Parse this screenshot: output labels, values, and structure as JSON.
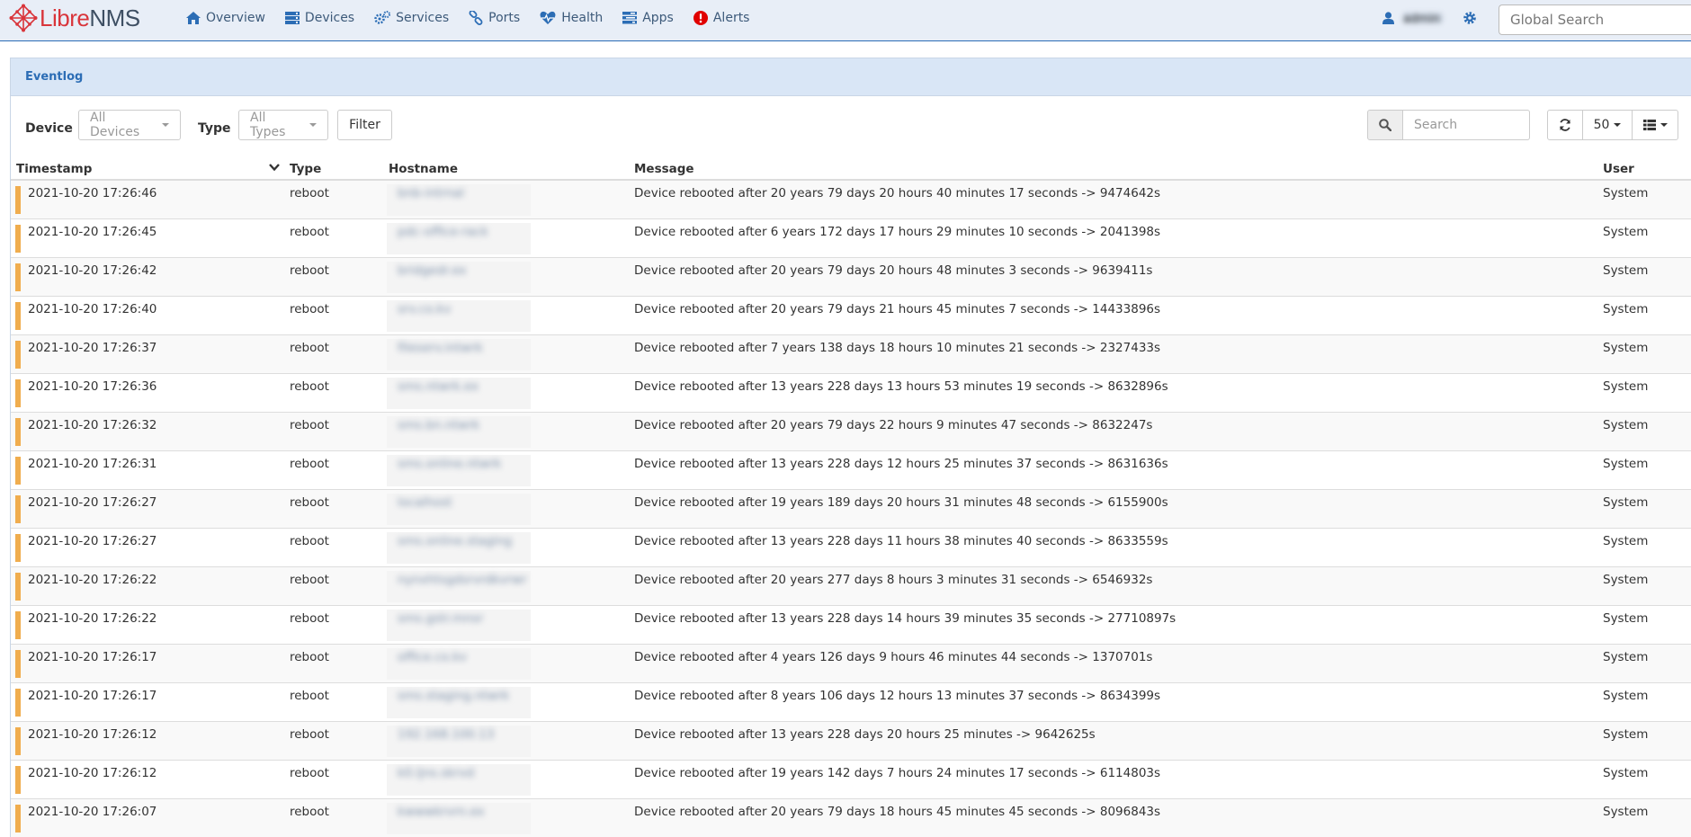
{
  "brand": {
    "part1": "Libre",
    "part2": "NMS"
  },
  "nav": [
    {
      "label": "Overview",
      "icon": "home-icon"
    },
    {
      "label": "Devices",
      "icon": "server-icon"
    },
    {
      "label": "Services",
      "icon": "cogs-icon"
    },
    {
      "label": "Ports",
      "icon": "link-icon"
    },
    {
      "label": "Health",
      "icon": "heartbeat-icon"
    },
    {
      "label": "Apps",
      "icon": "tasks-icon"
    },
    {
      "label": "Alerts",
      "icon": "exclamation-circle-icon"
    }
  ],
  "user": {
    "name": "admin",
    "icon": "user-icon"
  },
  "settings_icon": "gear-icon",
  "global_search": {
    "placeholder": "Global Search"
  },
  "panel": {
    "title": "Eventlog"
  },
  "filters": {
    "device_label": "Device",
    "device_value": "All Devices",
    "type_label": "Type",
    "type_value": "All Types",
    "filter_button": "Filter"
  },
  "table_search": {
    "placeholder": "Search"
  },
  "page_size": "50",
  "columns": {
    "timestamp": "Timestamp",
    "type": "Type",
    "hostname": "Hostname",
    "message": "Message",
    "user": "User"
  },
  "colors": {
    "accent": "#2c6db5",
    "severity_warning": "#f0ad4e",
    "brand_red": "#d9353b"
  },
  "rows": [
    {
      "timestamp": "2021-10-20 17:26:46",
      "type": "reboot",
      "hostname": "bnb-intrnal",
      "message": "Device rebooted after 20 years 79 days 20 hours 40 minutes 17 seconds -> 9474642s",
      "user": "System"
    },
    {
      "timestamp": "2021-10-20 17:26:45",
      "type": "reboot",
      "hostname": "pdc-office-rack",
      "message": "Device rebooted after 6 years 172 days 17 hours 29 minutes 10 seconds -> 2041398s",
      "user": "System"
    },
    {
      "timestamp": "2021-10-20 17:26:42",
      "type": "reboot",
      "hostname": "bridgedr.ex",
      "message": "Device rebooted after 20 years 79 days 20 hours 48 minutes 3 seconds -> 9639411s",
      "user": "System"
    },
    {
      "timestamp": "2021-10-20 17:26:40",
      "type": "reboot",
      "hostname": "srv.co.kv",
      "message": "Device rebooted after 20 years 79 days 21 hours 45 minutes 7 seconds -> 14433896s",
      "user": "System"
    },
    {
      "timestamp": "2021-10-20 17:26:37",
      "type": "reboot",
      "hostname": "fileserv.intwrk",
      "message": "Device rebooted after 7 years 138 days 18 hours 10 minutes 21 seconds -> 2327433s",
      "user": "System"
    },
    {
      "timestamp": "2021-10-20 17:26:36",
      "type": "reboot",
      "hostname": "sms.ntwrk.ex",
      "message": "Device rebooted after 13 years 228 days 13 hours 53 minutes 19 seconds -> 8632896s",
      "user": "System"
    },
    {
      "timestamp": "2021-10-20 17:26:32",
      "type": "reboot",
      "hostname": "sms.bn.ntwrk",
      "message": "Device rebooted after 20 years 79 days 22 hours 9 minutes 47 seconds -> 8632247s",
      "user": "System"
    },
    {
      "timestamp": "2021-10-20 17:26:31",
      "type": "reboot",
      "hostname": "sms.online.ntwrk",
      "message": "Device rebooted after 13 years 228 days 12 hours 25 minutes 37 seconds -> 8631636s",
      "user": "System"
    },
    {
      "timestamp": "2021-10-20 17:26:27",
      "type": "reboot",
      "hostname": "localhost",
      "message": "Device rebooted after 19 years 189 days 20 hours 31 minutes 48 seconds -> 6155900s",
      "user": "System"
    },
    {
      "timestamp": "2021-10-20 17:26:27",
      "type": "reboot",
      "hostname": "sms.online.staging",
      "message": "Device rebooted after 13 years 228 days 11 hours 38 minutes 40 seconds -> 8633559s",
      "user": "System"
    },
    {
      "timestamp": "2021-10-20 17:26:22",
      "type": "reboot",
      "hostname": "nynxhtsgdsrvrdkvrwr",
      "message": "Device rebooted after 20 years 277 days 8 hours 3 minutes 31 seconds -> 6546932s",
      "user": "System"
    },
    {
      "timestamp": "2021-10-20 17:26:22",
      "type": "reboot",
      "hostname": "sms.gstr.mnsr",
      "message": "Device rebooted after 13 years 228 days 14 hours 39 minutes 35 seconds -> 27710897s",
      "user": "System"
    },
    {
      "timestamp": "2021-10-20 17:26:17",
      "type": "reboot",
      "hostname": "office.co.kv",
      "message": "Device rebooted after 4 years 126 days 9 hours 46 minutes 44 seconds -> 1370701s",
      "user": "System"
    },
    {
      "timestamp": "2021-10-20 17:26:17",
      "type": "reboot",
      "hostname": "sms.staging.ntwrk",
      "message": "Device rebooted after 8 years 106 days 12 hours 13 minutes 37 seconds -> 8634399s",
      "user": "System"
    },
    {
      "timestamp": "2021-10-20 17:26:12",
      "type": "reboot",
      "hostname": "192.168.100.13",
      "message": "Device rebooted after 13 years 228 days 20 hours 25 minutes -> 9642625s",
      "user": "System"
    },
    {
      "timestamp": "2021-10-20 17:26:12",
      "type": "reboot",
      "hostname": "k0.ljns.skrvd",
      "message": "Device rebooted after 19 years 142 days 7 hours 24 minutes 17 seconds -> 6114803s",
      "user": "System"
    },
    {
      "timestamp": "2021-10-20 17:26:07",
      "type": "reboot",
      "hostname": "kwwwkrvrn.ex",
      "message": "Device rebooted after 20 years 79 days 18 hours 45 minutes 45 seconds -> 8096843s",
      "user": "System"
    }
  ]
}
